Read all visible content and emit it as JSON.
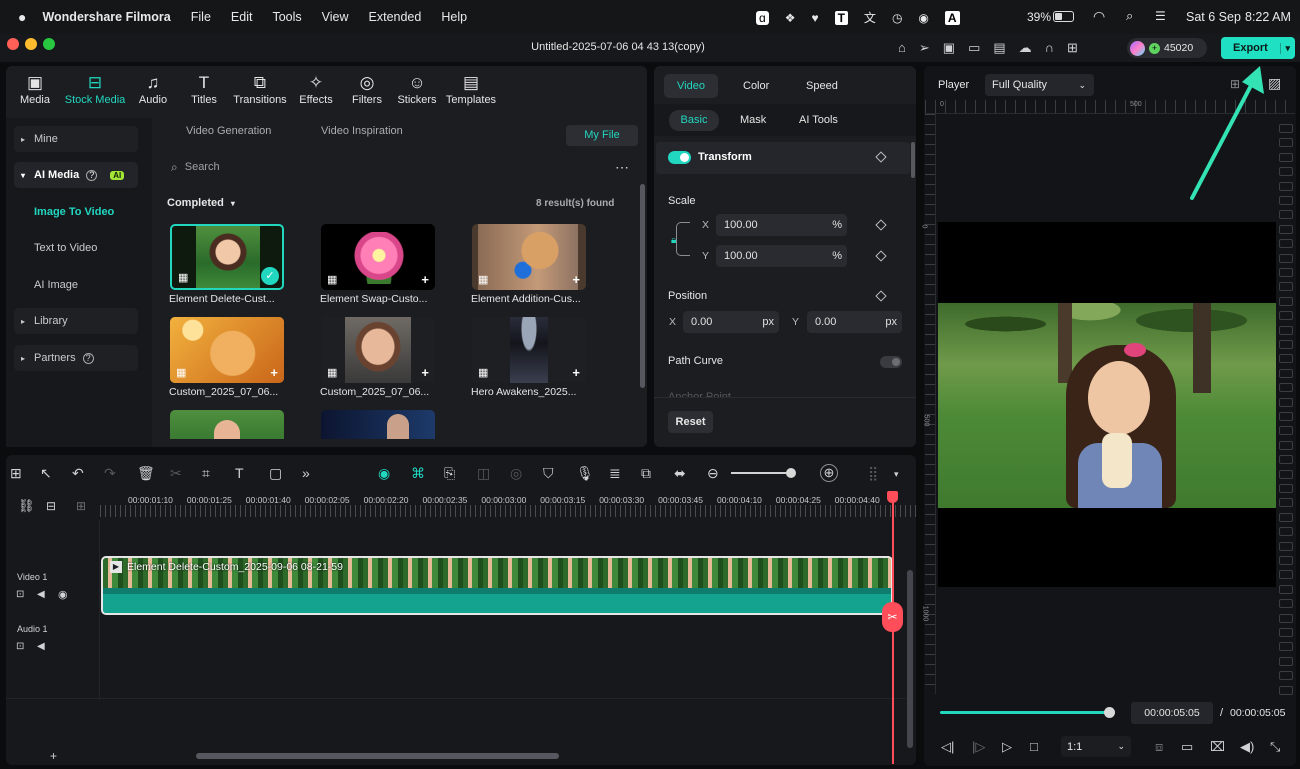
{
  "menubar": {
    "app": "Wondershare Filmora",
    "items": [
      "File",
      "Edit",
      "Tools",
      "View",
      "Extended",
      "Help"
    ],
    "battery": "39%",
    "date": "Sat 6 Sep",
    "time": "8:22 AM"
  },
  "window": {
    "title": "Untitled-2025-07-06 04 43 13(copy)",
    "credits": "45020",
    "export_label": "Export"
  },
  "tabs": [
    {
      "label": "Media",
      "icon": "media-icon"
    },
    {
      "label": "Stock Media",
      "icon": "stock-media-icon"
    },
    {
      "label": "Audio",
      "icon": "music-note-icon"
    },
    {
      "label": "Titles",
      "icon": "titles-icon"
    },
    {
      "label": "Transitions",
      "icon": "transitions-icon"
    },
    {
      "label": "Effects",
      "icon": "effects-icon"
    },
    {
      "label": "Filters",
      "icon": "filters-icon"
    },
    {
      "label": "Stickers",
      "icon": "stickers-icon"
    },
    {
      "label": "Templates",
      "icon": "templates-icon"
    }
  ],
  "sidebar": {
    "mine": "Mine",
    "ai_media": "AI Media",
    "ai_badge": "AI",
    "image_to_video": "Image To Video",
    "text_to_video": "Text to Video",
    "ai_image": "AI Image",
    "library": "Library",
    "partners": "Partners"
  },
  "media": {
    "subtabs": [
      "Video Generation",
      "Video Inspiration"
    ],
    "my_file": "My File",
    "search_placeholder": "Search",
    "filter": "Completed",
    "results": "8 result(s) found",
    "items": [
      {
        "caption": "Element Delete-Cust..."
      },
      {
        "caption": "Element Swap-Custo..."
      },
      {
        "caption": "Element Addition-Cus..."
      },
      {
        "caption": "Custom_2025_07_06..."
      },
      {
        "caption": "Custom_2025_07_06..."
      },
      {
        "caption": "Hero Awakens_2025..."
      }
    ]
  },
  "properties": {
    "tabs": [
      "Video",
      "Color",
      "Speed"
    ],
    "subtabs": [
      "Basic",
      "Mask",
      "AI Tools"
    ],
    "transform": "Transform",
    "scale": "Scale",
    "x_label": "X",
    "y_label": "Y",
    "scale_x": "100.00",
    "scale_y": "100.00",
    "percent": "%",
    "position": "Position",
    "pos_x": "0.00",
    "pos_y": "0.00",
    "px": "px",
    "path_curve": "Path Curve",
    "anchor_point": "Anchor Point",
    "reset": "Reset"
  },
  "player": {
    "label": "Player",
    "quality": "Full Quality",
    "ruler_h": [
      "0",
      "500"
    ],
    "ruler_v": [
      "0",
      "500",
      "1000"
    ],
    "current_time": "00:00:05:05",
    "separator": "/",
    "total_time": "00:00:05:05",
    "ratio": "1:1",
    "progress": 1.0
  },
  "timeline": {
    "timecodes": [
      "00:00:01:10",
      "00:00:01:25",
      "00:00:01:40",
      "00:00:02:05",
      "00:00:02:20",
      "00:00:02:35",
      "00:00:03:00",
      "00:00:03:15",
      "00:00:03:30",
      "00:00:03:45",
      "00:00:04:10",
      "00:00:04:25",
      "00:00:04:40"
    ],
    "video_track": "Video 1",
    "audio_track": "Audio 1",
    "clip_name": "Element Delete-Custom_2025-09-06 08-21-59",
    "add": "+"
  }
}
